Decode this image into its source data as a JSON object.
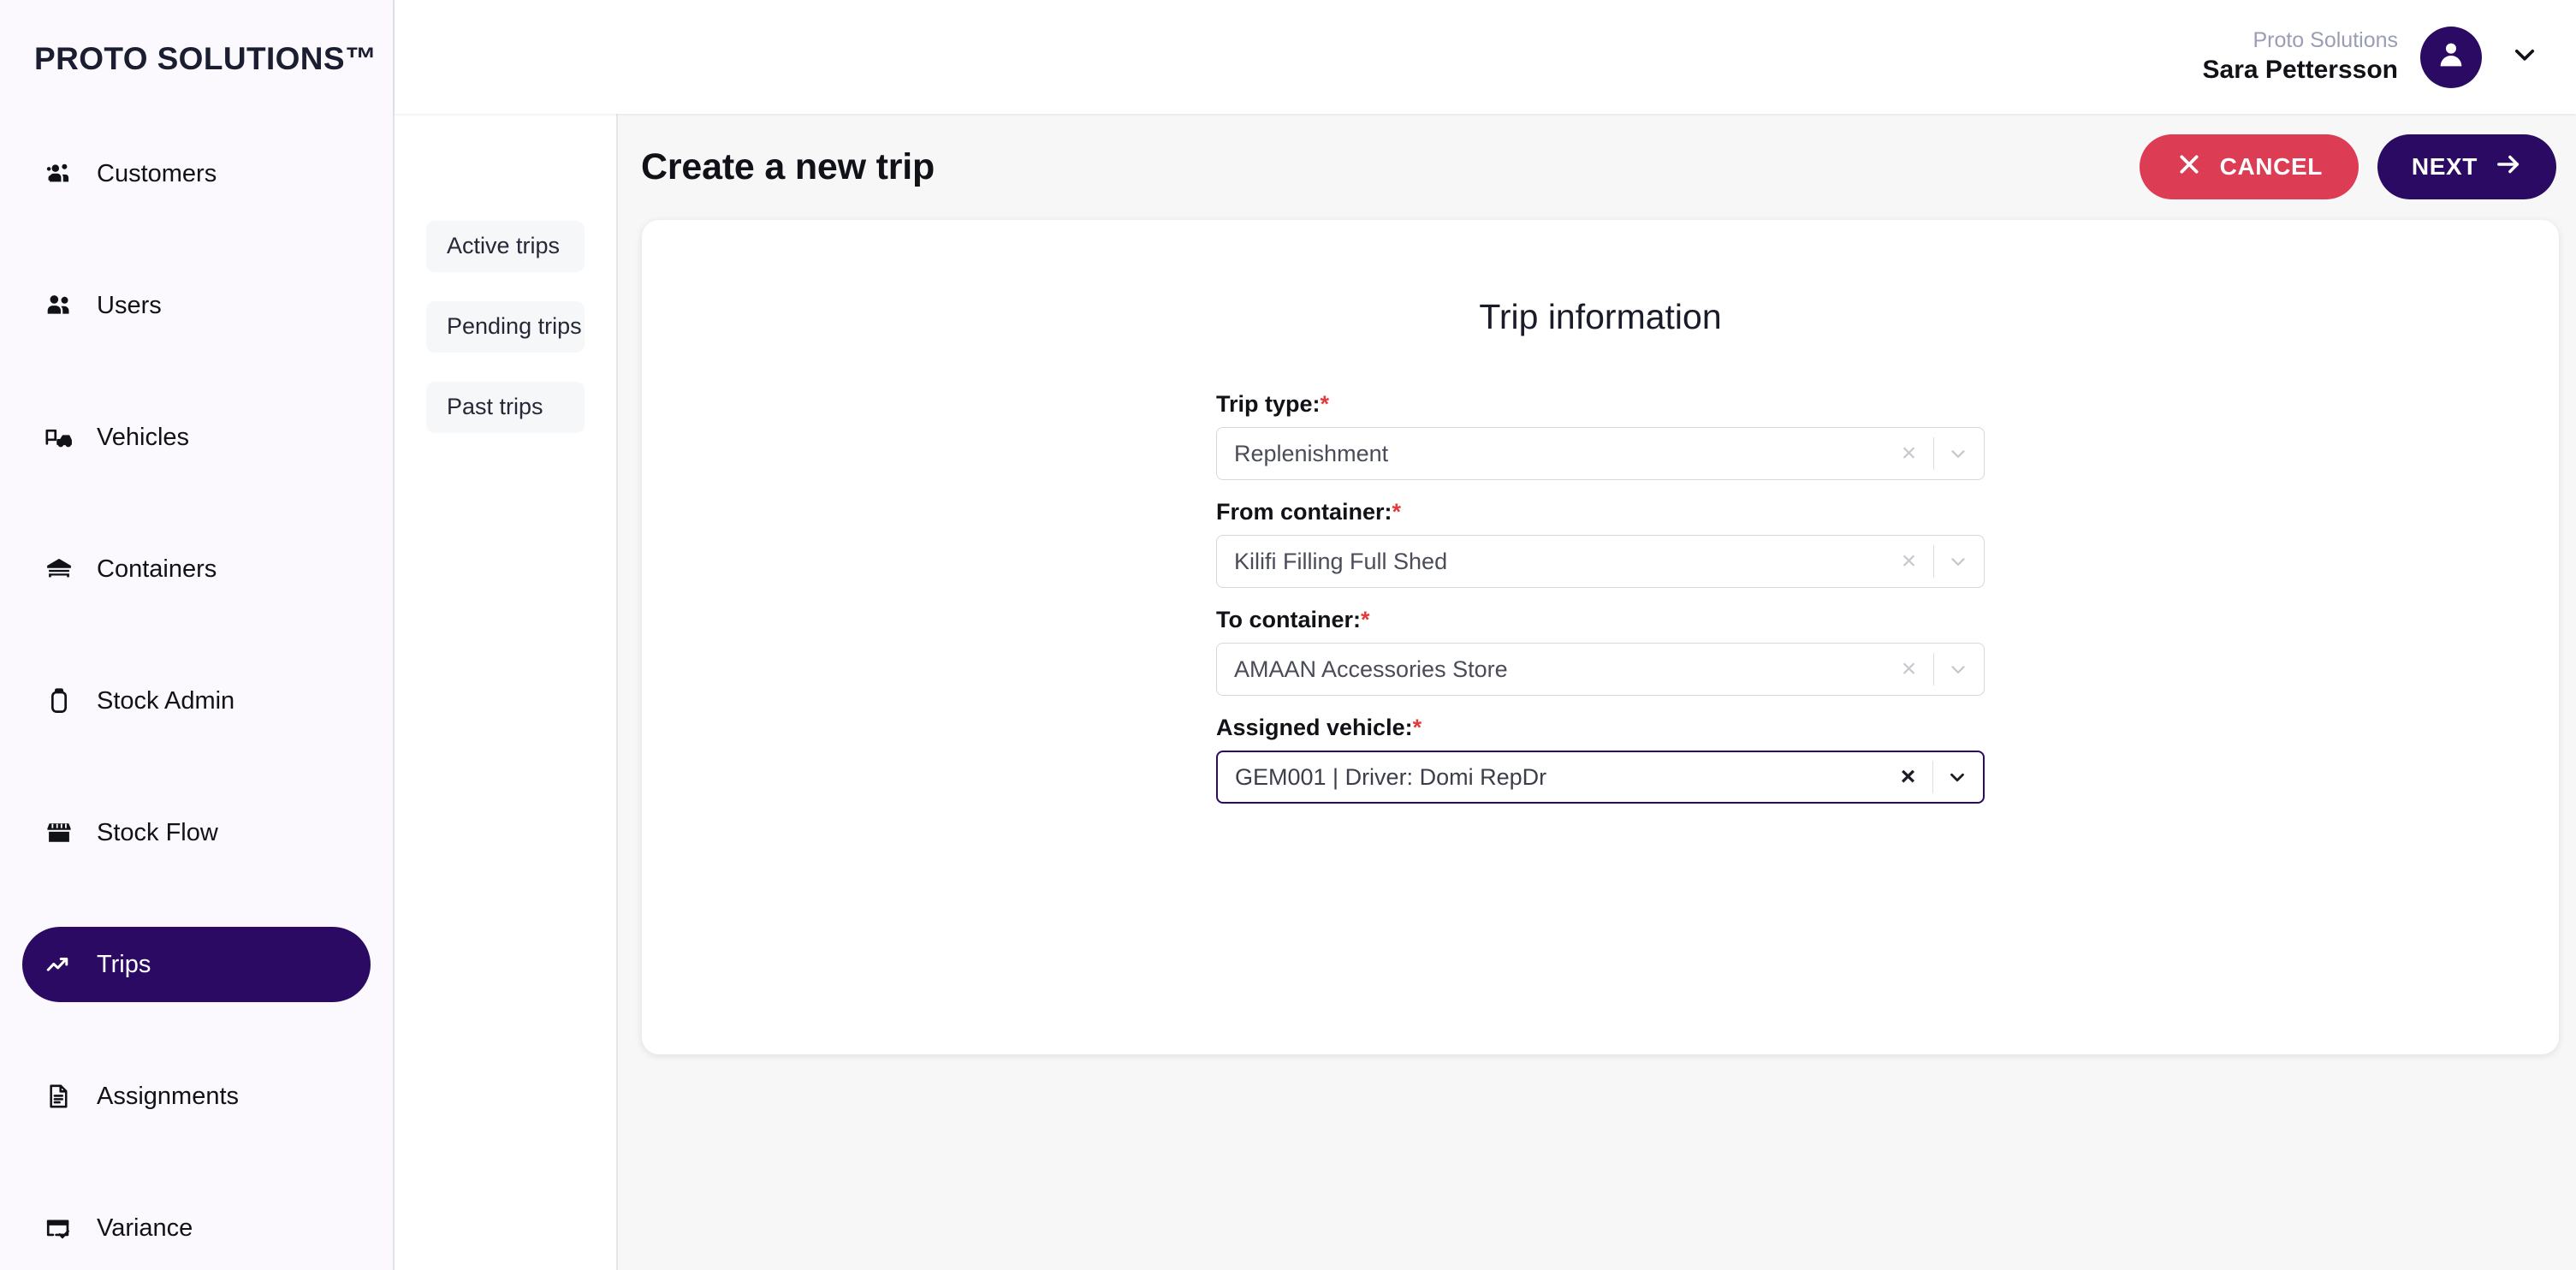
{
  "brand": {
    "name": "PROTO SOLUTIONS™"
  },
  "sidebar": {
    "items": [
      {
        "label": "Customers",
        "icon": "customers-icon",
        "active": false
      },
      {
        "label": "Users",
        "icon": "users-icon",
        "active": false
      },
      {
        "label": "Vehicles",
        "icon": "vehicles-icon",
        "active": false
      },
      {
        "label": "Containers",
        "icon": "containers-icon",
        "active": false
      },
      {
        "label": "Stock Admin",
        "icon": "stock-admin-icon",
        "active": false
      },
      {
        "label": "Stock Flow",
        "icon": "stock-flow-icon",
        "active": false
      },
      {
        "label": "Trips",
        "icon": "trips-icon",
        "active": true
      },
      {
        "label": "Assignments",
        "icon": "assignments-icon",
        "active": false
      },
      {
        "label": "Variance",
        "icon": "variance-icon",
        "active": false
      }
    ]
  },
  "topbar": {
    "org": "Proto Solutions",
    "user_name": "Sara Pettersson",
    "avatar_icon": "user-avatar-icon",
    "caret_icon": "chevron-down-icon"
  },
  "tabs": [
    {
      "label": "Active trips"
    },
    {
      "label": "Pending trips"
    },
    {
      "label": "Past trips"
    }
  ],
  "page": {
    "title": "Create a new trip",
    "cancel_label": "CANCEL",
    "next_label": "NEXT",
    "cancel_icon": "close-x-icon",
    "next_icon": "arrow-right-icon"
  },
  "form": {
    "heading": "Trip information",
    "fields": [
      {
        "label": "Trip type:",
        "required": "*",
        "value": "Replenishment",
        "focused": false
      },
      {
        "label": "From container:",
        "required": "*",
        "value": "Kilifi Filling Full Shed",
        "focused": false
      },
      {
        "label": "To container:",
        "required": "*",
        "value": "AMAAN Accessories Store",
        "focused": false
      },
      {
        "label": "Assigned vehicle:",
        "required": "*",
        "value": "GEM001 | Driver: Domi RepDr",
        "focused": true
      }
    ],
    "clear_glyph": "×"
  },
  "colors": {
    "brand_purple": "#2a0a63",
    "danger_red": "#dc3c54",
    "required_red": "#e33b3b",
    "sidebar_bg": "#fbf9fd",
    "content_bg": "#f7f7f8"
  }
}
